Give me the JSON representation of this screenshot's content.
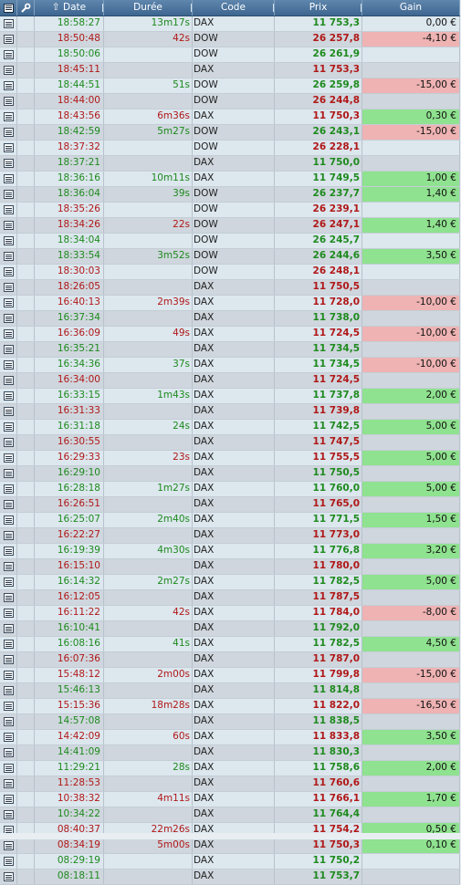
{
  "header": {
    "date": "Date",
    "duree": "Durée",
    "code": "Code",
    "prix": "Prix",
    "gain": "Gain"
  },
  "colors": {
    "up": "#1e8a1e",
    "down": "#b01818",
    "gain_positive": "#8fe28f",
    "gain_negative": "#efb3b3"
  },
  "rows": [
    {
      "time": "18:58:27",
      "dur": "13m17s",
      "code": "DAX",
      "prix": "11 753,3",
      "gain": "0,00 €",
      "dir": "up",
      "g": ""
    },
    {
      "time": "18:50:48",
      "dur": "42s",
      "code": "DOW",
      "prix": "26 257,8",
      "gain": "-4,10 €",
      "dir": "down",
      "g": "neg"
    },
    {
      "time": "18:50:06",
      "dur": "",
      "code": "DOW",
      "prix": "26 261,9",
      "gain": "",
      "dir": "up",
      "g": ""
    },
    {
      "time": "18:45:11",
      "dur": "",
      "code": "DAX",
      "prix": "11 753,3",
      "gain": "",
      "dir": "down",
      "g": ""
    },
    {
      "time": "18:44:51",
      "dur": "51s",
      "code": "DOW",
      "prix": "26 259,8",
      "gain": "-15,00 €",
      "dir": "up",
      "g": "neg"
    },
    {
      "time": "18:44:00",
      "dur": "",
      "code": "DOW",
      "prix": "26 244,8",
      "gain": "",
      "dir": "down",
      "g": ""
    },
    {
      "time": "18:43:56",
      "dur": "6m36s",
      "code": "DAX",
      "prix": "11 750,3",
      "gain": "0,30 €",
      "dir": "down",
      "g": "pos"
    },
    {
      "time": "18:42:59",
      "dur": "5m27s",
      "code": "DOW",
      "prix": "26 243,1",
      "gain": "-15,00 €",
      "dir": "up",
      "g": "neg"
    },
    {
      "time": "18:37:32",
      "dur": "",
      "code": "DOW",
      "prix": "26 228,1",
      "gain": "",
      "dir": "down",
      "g": ""
    },
    {
      "time": "18:37:21",
      "dur": "",
      "code": "DAX",
      "prix": "11 750,0",
      "gain": "",
      "dir": "up",
      "g": ""
    },
    {
      "time": "18:36:16",
      "dur": "10m11s",
      "code": "DAX",
      "prix": "11 749,5",
      "gain": "1,00 €",
      "dir": "up",
      "g": "pos"
    },
    {
      "time": "18:36:04",
      "dur": "39s",
      "code": "DOW",
      "prix": "26 237,7",
      "gain": "1,40 €",
      "dir": "up",
      "g": "pos"
    },
    {
      "time": "18:35:26",
      "dur": "",
      "code": "DOW",
      "prix": "26 239,1",
      "gain": "",
      "dir": "down",
      "g": ""
    },
    {
      "time": "18:34:26",
      "dur": "22s",
      "code": "DOW",
      "prix": "26 247,1",
      "gain": "1,40 €",
      "dir": "down",
      "g": "pos"
    },
    {
      "time": "18:34:04",
      "dur": "",
      "code": "DOW",
      "prix": "26 245,7",
      "gain": "",
      "dir": "up",
      "g": ""
    },
    {
      "time": "18:33:54",
      "dur": "3m52s",
      "code": "DOW",
      "prix": "26 244,6",
      "gain": "3,50 €",
      "dir": "up",
      "g": "pos"
    },
    {
      "time": "18:30:03",
      "dur": "",
      "code": "DOW",
      "prix": "26 248,1",
      "gain": "",
      "dir": "down",
      "g": ""
    },
    {
      "time": "18:26:05",
      "dur": "",
      "code": "DAX",
      "prix": "11 750,5",
      "gain": "",
      "dir": "down",
      "g": ""
    },
    {
      "time": "16:40:13",
      "dur": "2m39s",
      "code": "DAX",
      "prix": "11 728,0",
      "gain": "-10,00 €",
      "dir": "down",
      "g": "neg"
    },
    {
      "time": "16:37:34",
      "dur": "",
      "code": "DAX",
      "prix": "11 738,0",
      "gain": "",
      "dir": "up",
      "g": ""
    },
    {
      "time": "16:36:09",
      "dur": "49s",
      "code": "DAX",
      "prix": "11 724,5",
      "gain": "-10,00 €",
      "dir": "down",
      "g": "neg"
    },
    {
      "time": "16:35:21",
      "dur": "",
      "code": "DAX",
      "prix": "11 734,5",
      "gain": "",
      "dir": "up",
      "g": ""
    },
    {
      "time": "16:34:36",
      "dur": "37s",
      "code": "DAX",
      "prix": "11 734,5",
      "gain": "-10,00 €",
      "dir": "up",
      "g": "neg"
    },
    {
      "time": "16:34:00",
      "dur": "",
      "code": "DAX",
      "prix": "11 724,5",
      "gain": "",
      "dir": "down",
      "g": ""
    },
    {
      "time": "16:33:15",
      "dur": "1m43s",
      "code": "DAX",
      "prix": "11 737,8",
      "gain": "2,00 €",
      "dir": "up",
      "g": "pos"
    },
    {
      "time": "16:31:33",
      "dur": "",
      "code": "DAX",
      "prix": "11 739,8",
      "gain": "",
      "dir": "down",
      "g": ""
    },
    {
      "time": "16:31:18",
      "dur": "24s",
      "code": "DAX",
      "prix": "11 742,5",
      "gain": "5,00 €",
      "dir": "up",
      "g": "pos"
    },
    {
      "time": "16:30:55",
      "dur": "",
      "code": "DAX",
      "prix": "11 747,5",
      "gain": "",
      "dir": "down",
      "g": ""
    },
    {
      "time": "16:29:33",
      "dur": "23s",
      "code": "DAX",
      "prix": "11 755,5",
      "gain": "5,00 €",
      "dir": "down",
      "g": "pos"
    },
    {
      "time": "16:29:10",
      "dur": "",
      "code": "DAX",
      "prix": "11 750,5",
      "gain": "",
      "dir": "up",
      "g": ""
    },
    {
      "time": "16:28:18",
      "dur": "1m27s",
      "code": "DAX",
      "prix": "11 760,0",
      "gain": "5,00 €",
      "dir": "up",
      "g": "pos"
    },
    {
      "time": "16:26:51",
      "dur": "",
      "code": "DAX",
      "prix": "11 765,0",
      "gain": "",
      "dir": "down",
      "g": ""
    },
    {
      "time": "16:25:07",
      "dur": "2m40s",
      "code": "DAX",
      "prix": "11 771,5",
      "gain": "1,50 €",
      "dir": "up",
      "g": "pos"
    },
    {
      "time": "16:22:27",
      "dur": "",
      "code": "DAX",
      "prix": "11 773,0",
      "gain": "",
      "dir": "down",
      "g": ""
    },
    {
      "time": "16:19:39",
      "dur": "4m30s",
      "code": "DAX",
      "prix": "11 776,8",
      "gain": "3,20 €",
      "dir": "up",
      "g": "pos"
    },
    {
      "time": "16:15:10",
      "dur": "",
      "code": "DAX",
      "prix": "11 780,0",
      "gain": "",
      "dir": "down",
      "g": ""
    },
    {
      "time": "16:14:32",
      "dur": "2m27s",
      "code": "DAX",
      "prix": "11 782,5",
      "gain": "5,00 €",
      "dir": "up",
      "g": "pos"
    },
    {
      "time": "16:12:05",
      "dur": "",
      "code": "DAX",
      "prix": "11 787,5",
      "gain": "",
      "dir": "down",
      "g": ""
    },
    {
      "time": "16:11:22",
      "dur": "42s",
      "code": "DAX",
      "prix": "11 784,0",
      "gain": "-8,00 €",
      "dir": "down",
      "g": "neg"
    },
    {
      "time": "16:10:41",
      "dur": "",
      "code": "DAX",
      "prix": "11 792,0",
      "gain": "",
      "dir": "up",
      "g": ""
    },
    {
      "time": "16:08:16",
      "dur": "41s",
      "code": "DAX",
      "prix": "11 782,5",
      "gain": "4,50 €",
      "dir": "up",
      "g": "pos"
    },
    {
      "time": "16:07:36",
      "dur": "",
      "code": "DAX",
      "prix": "11 787,0",
      "gain": "",
      "dir": "down",
      "g": ""
    },
    {
      "time": "15:48:12",
      "dur": "2m00s",
      "code": "DAX",
      "prix": "11 799,8",
      "gain": "-15,00 €",
      "dir": "down",
      "g": "neg"
    },
    {
      "time": "15:46:13",
      "dur": "",
      "code": "DAX",
      "prix": "11 814,8",
      "gain": "",
      "dir": "up",
      "g": ""
    },
    {
      "time": "15:15:36",
      "dur": "18m28s",
      "code": "DAX",
      "prix": "11 822,0",
      "gain": "-16,50 €",
      "dir": "down",
      "g": "neg"
    },
    {
      "time": "14:57:08",
      "dur": "",
      "code": "DAX",
      "prix": "11 838,5",
      "gain": "",
      "dir": "up",
      "g": ""
    },
    {
      "time": "14:42:09",
      "dur": "60s",
      "code": "DAX",
      "prix": "11 833,8",
      "gain": "3,50 €",
      "dir": "down",
      "g": "pos"
    },
    {
      "time": "14:41:09",
      "dur": "",
      "code": "DAX",
      "prix": "11 830,3",
      "gain": "",
      "dir": "up",
      "g": ""
    },
    {
      "time": "11:29:21",
      "dur": "28s",
      "code": "DAX",
      "prix": "11 758,6",
      "gain": "2,00 €",
      "dir": "up",
      "g": "pos"
    },
    {
      "time": "11:28:53",
      "dur": "",
      "code": "DAX",
      "prix": "11 760,6",
      "gain": "",
      "dir": "down",
      "g": ""
    },
    {
      "time": "10:38:32",
      "dur": "4m11s",
      "code": "DAX",
      "prix": "11 766,1",
      "gain": "1,70 €",
      "dir": "down",
      "g": "pos"
    },
    {
      "time": "10:34:22",
      "dur": "",
      "code": "DAX",
      "prix": "11 764,4",
      "gain": "",
      "dir": "up",
      "g": ""
    },
    {
      "time": "08:40:37",
      "dur": "22m26s",
      "code": "DAX",
      "prix": "11 754,2",
      "gain": "0,50 €",
      "dir": "down",
      "g": "pos"
    },
    {
      "time": "08:34:19",
      "dur": "5m00s",
      "code": "DAX",
      "prix": "11 750,3",
      "gain": "0,10 €",
      "dir": "down",
      "g": "pos"
    },
    {
      "time": "08:29:19",
      "dur": "",
      "code": "DAX",
      "prix": "11 750,2",
      "gain": "",
      "dir": "up",
      "g": ""
    },
    {
      "time": "08:18:11",
      "dur": "",
      "code": "DAX",
      "prix": "11 753,7",
      "gain": "",
      "dir": "up",
      "g": ""
    }
  ]
}
